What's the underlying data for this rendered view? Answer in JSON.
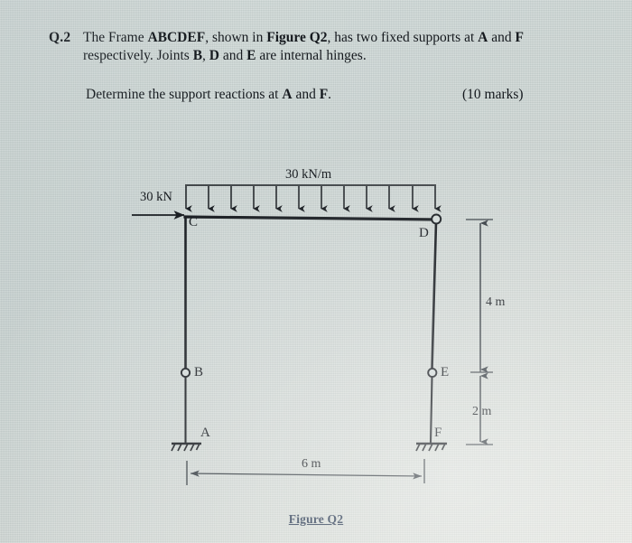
{
  "question": {
    "number": "Q.2",
    "body_prefix": "The Frame ",
    "frame_name": "ABCDEF",
    "body_mid": ", shown in ",
    "figure_ref": "Figure Q2",
    "body_after": ", has two fixed supports at ",
    "support_a": "A",
    "and_1": " and ",
    "support_f": "F",
    "body_line2_start": "respectively. Joints ",
    "hinge_b": "B",
    "comma_1": ", ",
    "hinge_d": "D",
    "and_2": " and ",
    "hinge_e": "E",
    "body_line2_end": " are internal hinges.",
    "determine_prefix": "Determine the support reactions at ",
    "determine_a": "A",
    "determine_and": " and ",
    "determine_f": "F",
    "determine_suffix": ".",
    "marks": "(10 marks)"
  },
  "figure": {
    "caption": "Figure Q2",
    "point_load_label": "30 kN",
    "udl_label": "30 kN/m",
    "nodes": {
      "A": "A",
      "B": "B",
      "C": "C",
      "D": "D",
      "E": "E",
      "F": "F"
    },
    "dimensions": {
      "span": "6 m",
      "upper_height": "4 m",
      "lower_height": "2 m"
    },
    "udl_arrow_count": 12,
    "colors": {
      "ink": "#14181d",
      "paper": "#cfd8d6",
      "caption": "#2a3a52"
    }
  },
  "chart_data": {
    "type": "diagram",
    "title": "Figure Q2 - Frame ABCDEF",
    "description": "Plane frame with two fixed supports (A, F) and three internal hinges (B, D, E), loaded by a horizontal point load at C and a uniformly distributed load on beam CD.",
    "geometry": {
      "span_m": 6,
      "upper_column_height_m": 4,
      "lower_column_height_m": 2,
      "total_column_height_m": 6
    },
    "members": [
      {
        "name": "A-B",
        "from": "A",
        "to": "B",
        "type": "column"
      },
      {
        "name": "B-C",
        "from": "B",
        "to": "C",
        "type": "column"
      },
      {
        "name": "C-D",
        "from": "C",
        "to": "D",
        "type": "beam"
      },
      {
        "name": "D-E",
        "from": "D",
        "to": "E",
        "type": "column"
      },
      {
        "name": "E-F",
        "from": "E",
        "to": "F",
        "type": "column"
      }
    ],
    "supports": [
      {
        "node": "A",
        "type": "fixed"
      },
      {
        "node": "F",
        "type": "fixed"
      }
    ],
    "hinges": [
      "B",
      "D",
      "E"
    ],
    "loads": [
      {
        "type": "point",
        "magnitude": 30,
        "unit": "kN",
        "at": "C",
        "direction": "horizontal-right",
        "label": "30 kN"
      },
      {
        "type": "udl",
        "magnitude": 30,
        "unit": "kN/m",
        "on": "C-D",
        "direction": "downward",
        "label": "30 kN/m"
      }
    ]
  }
}
